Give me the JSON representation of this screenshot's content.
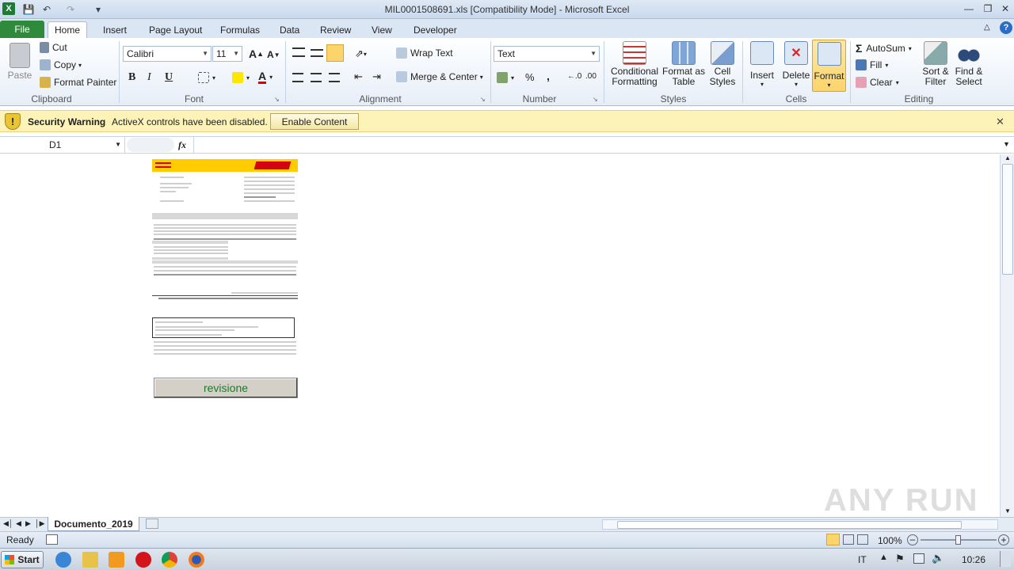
{
  "window": {
    "title": "MIL0001508691.xls  [Compatibility Mode]  -  Microsoft Excel"
  },
  "tabs": [
    "File",
    "Home",
    "Insert",
    "Page Layout",
    "Formulas",
    "Data",
    "Review",
    "View",
    "Developer"
  ],
  "ribbon": {
    "clipboard": {
      "paste": "Paste",
      "cut": "Cut",
      "copy": "Copy",
      "format_painter": "Format Painter",
      "label": "Clipboard"
    },
    "font": {
      "name": "Calibri",
      "size": "11",
      "label": "Font",
      "bold": "B",
      "italic": "I",
      "underline": "U"
    },
    "alignment": {
      "wrap": "Wrap Text",
      "merge": "Merge & Center",
      "label": "Alignment"
    },
    "number": {
      "format": "Text",
      "label": "Number",
      "percent": "%",
      "comma": ","
    },
    "styles": {
      "conditional": "Conditional Formatting",
      "format_table": "Format as Table",
      "cell_styles": "Cell Styles",
      "label": "Styles"
    },
    "cells": {
      "insert": "Insert",
      "delete": "Delete",
      "format": "Format",
      "label": "Cells"
    },
    "editing": {
      "autosum": "AutoSum",
      "fill": "Fill",
      "clear": "Clear",
      "sort": "Sort & Filter",
      "find": "Find & Select",
      "label": "Editing"
    }
  },
  "security": {
    "title": "Security Warning",
    "message": "ActiveX controls have been disabled.",
    "button": "Enable Content"
  },
  "formula_bar": {
    "cell_ref": "D1",
    "fx": "fx",
    "value": ""
  },
  "document": {
    "button": "revisione"
  },
  "sheet_tabs": [
    "Documento_2019"
  ],
  "status": {
    "ready": "Ready",
    "zoom": "100%"
  },
  "taskbar": {
    "start": "Start",
    "lang": "IT",
    "time": "10:26"
  },
  "watermark": "ANY RUN",
  "colors": {
    "dhl_yellow": "#ffcc00",
    "dhl_red": "#d40511",
    "excel_green": "#2f8a3b"
  }
}
